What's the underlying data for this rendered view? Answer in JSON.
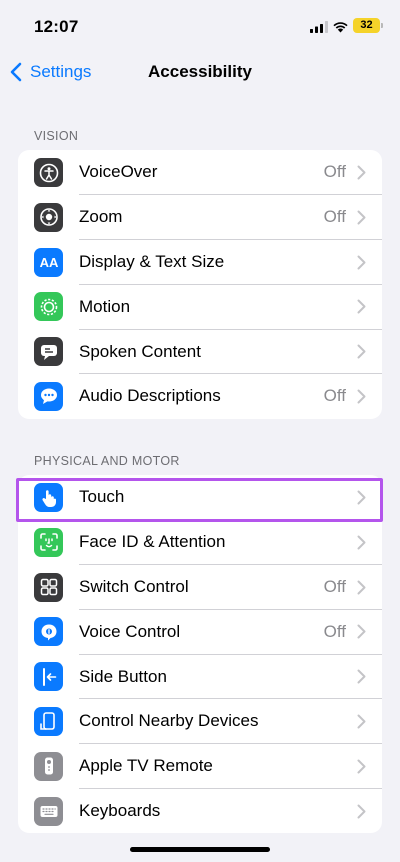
{
  "status_bar": {
    "time": "12:07",
    "battery": "32"
  },
  "nav": {
    "back_label": "Settings",
    "title": "Accessibility"
  },
  "colors": {
    "accent": "#0a7aff",
    "highlight": "#b455ec"
  },
  "sections": [
    {
      "header": "VISION",
      "items": [
        {
          "label": "VoiceOver",
          "value": "Off",
          "icon": "voiceover-icon",
          "icon_color": "#3a3a3c"
        },
        {
          "label": "Zoom",
          "value": "Off",
          "icon": "zoom-icon",
          "icon_color": "#3a3a3c"
        },
        {
          "label": "Display & Text Size",
          "value": "",
          "icon": "text-size-icon",
          "icon_color": "#0a7aff"
        },
        {
          "label": "Motion",
          "value": "",
          "icon": "motion-icon",
          "icon_color": "#34c759"
        },
        {
          "label": "Spoken Content",
          "value": "",
          "icon": "spoken-content-icon",
          "icon_color": "#3a3a3c"
        },
        {
          "label": "Audio Descriptions",
          "value": "Off",
          "icon": "audio-descriptions-icon",
          "icon_color": "#0a7aff"
        }
      ]
    },
    {
      "header": "PHYSICAL AND MOTOR",
      "items": [
        {
          "label": "Touch",
          "value": "",
          "icon": "touch-hand-icon",
          "icon_color": "#0a7aff"
        },
        {
          "label": "Face ID & Attention",
          "value": "",
          "icon": "face-id-icon",
          "icon_color": "#34c759"
        },
        {
          "label": "Switch Control",
          "value": "Off",
          "icon": "switch-control-icon",
          "icon_color": "#3a3a3c"
        },
        {
          "label": "Voice Control",
          "value": "Off",
          "icon": "voice-control-icon",
          "icon_color": "#0a7aff"
        },
        {
          "label": "Side Button",
          "value": "",
          "icon": "side-button-icon",
          "icon_color": "#0a7aff"
        },
        {
          "label": "Control Nearby Devices",
          "value": "",
          "icon": "nearby-devices-icon",
          "icon_color": "#0a7aff"
        },
        {
          "label": "Apple TV Remote",
          "value": "",
          "icon": "tv-remote-icon",
          "icon_color": "#8e8e93"
        },
        {
          "label": "Keyboards",
          "value": "",
          "icon": "keyboard-icon",
          "icon_color": "#8e8e93"
        }
      ]
    }
  ]
}
